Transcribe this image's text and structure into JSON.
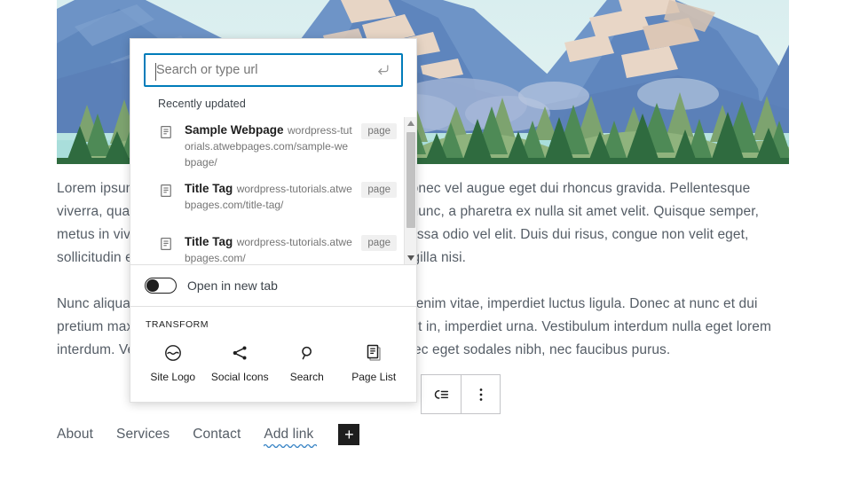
{
  "cover": {
    "alt": "mountain-lake-forest-illustration",
    "colors": {
      "sky": "#dff0ef",
      "mountain_far": "#7b99c4",
      "mountain_mid": "#5d83b8",
      "mountain_dark": "#4a6fa5",
      "snow": "#e8d6c6",
      "forest_dark": "#2f6b3f",
      "forest_mid": "#4e8a56",
      "forest_light": "#86ac76",
      "lake": "#a9dedb"
    }
  },
  "content": {
    "paragraphs": [
      "Lorem ipsum dolor sit amet, consectetur adipiscing elit. Donec vel augue eget dui rhoncus gravida. Pellentesque viverra, quam vel maximus lobortis, lorem lacus molestie nunc, a pharetra ex nulla sit amet velit. Quisque semper, metus in viverra lacinia, justo sapien ultricies arcu, nec massa odio vel elit. Duis dui risus, congue non velit eget, sollicitudin euismod libero. Nulla malesuada arcu sed, fringilla nisi.",
      "Nunc aliquam lorem quis lacus tincidunt, scelerisque eget enim vitae, imperdiet luctus ligula. Donec at nunc et dui pretium maximus. Integer nec libero bibendum, aliquam elit in, imperdiet urna. Vestibulum interdum nulla eget lorem interdum. Vestibulum posuere nisi ac cursus suscipit. Donec eget sodales nibh, nec faucibus purus."
    ]
  },
  "navigation": {
    "items": [
      {
        "label": "About"
      },
      {
        "label": "Services"
      },
      {
        "label": "Contact"
      },
      {
        "label": "Add link"
      }
    ],
    "appender_label": "+"
  },
  "block_toolbar": {
    "buttons": [
      {
        "name": "link-settings",
        "label": ""
      },
      {
        "name": "more-options",
        "label": ""
      }
    ]
  },
  "link_popover": {
    "search": {
      "placeholder": "Search or type url",
      "value": "",
      "submit_icon": "return-arrow-icon"
    },
    "results_label": "Recently updated",
    "results": [
      {
        "title": "Sample Webpage",
        "url": "wordpress-tutorials.atwebpages.com/sample-webpage/",
        "badge": "page"
      },
      {
        "title": "Title Tag",
        "url": "wordpress-tutorials.atwebpages.com/title-tag/",
        "badge": "page"
      },
      {
        "title": "Title Tag",
        "url": "wordpress-tutorials.atwebpages.com/",
        "badge": "page"
      }
    ],
    "new_tab": {
      "label": "Open in new tab",
      "enabled": false
    },
    "transform": {
      "title": "TRANSFORM",
      "options": [
        {
          "label": "Site Logo",
          "icon": "site-logo-icon"
        },
        {
          "label": "Social Icons",
          "icon": "share-icon"
        },
        {
          "label": "Search",
          "icon": "search-icon"
        },
        {
          "label": "Page List",
          "icon": "page-list-icon"
        }
      ]
    }
  },
  "theme": {
    "accent": "#007cba",
    "text": "#555d66",
    "heading": "#1e1e1e",
    "muted": "#757575",
    "border": "#e0e0e0"
  }
}
